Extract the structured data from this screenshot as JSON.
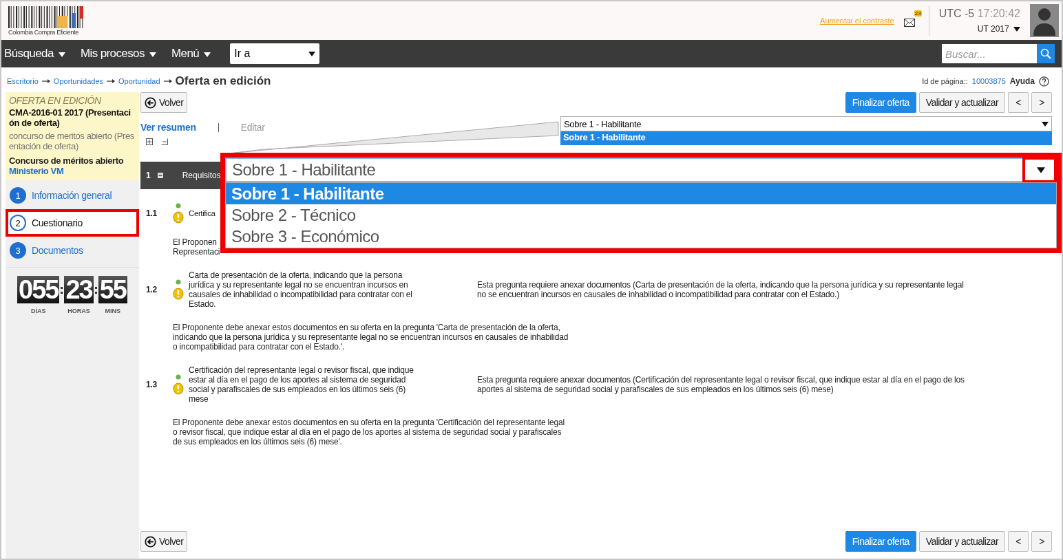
{
  "header": {
    "logo_text": "Colombia Compra Eficiente",
    "contrast_link": "Aumentar el contraste",
    "mail_badge": "23",
    "timezone": "UTC -5",
    "clock": "17:20:42",
    "user": "UT 2017"
  },
  "nav": {
    "items": [
      "Búsqueda",
      "Mis procesos",
      "Menú"
    ],
    "goto": {
      "value": "Ir a"
    },
    "search": {
      "placeholder": "Buscar..."
    }
  },
  "breadcrumb": {
    "links": [
      "Escritorio",
      "Oportunidades",
      "Oportunidad"
    ],
    "current": "Oferta en edición"
  },
  "page_id": {
    "label": "Id de página::",
    "value": "10003875",
    "help": "Ayuda"
  },
  "sidebar": {
    "status": "OFERTA EN EDICIÓN",
    "title": "CMA-2016-01 2017 (Presentación de oferta)",
    "description": "concurso de meritos abierto (Presentación de oferta)",
    "type": "Concurso de méritos abierto",
    "entity": "Ministerio VM",
    "steps": [
      {
        "number": "1",
        "label": "Información general",
        "selected": false
      },
      {
        "number": "2",
        "label": "Cuestionario",
        "selected": true
      },
      {
        "number": "3",
        "label": "Documentos",
        "selected": false
      }
    ],
    "countdown": [
      {
        "value": "055",
        "unit": "DÍAS"
      },
      {
        "value": "23",
        "unit": "HORAS"
      },
      {
        "value": "55",
        "unit": "MINS"
      }
    ]
  },
  "toolbars": [
    {
      "back": "Volver",
      "primary": "Finalizar oferta",
      "secondary": "Validar y actualizar",
      "prev": "<",
      "next": ">"
    },
    {
      "back": "Volver",
      "primary": "Finalizar oferta",
      "secondary": "Validar y actualizar",
      "prev": "<",
      "next": ">"
    }
  ],
  "view_links": [
    {
      "label": "Ver resumen",
      "disabled": false
    },
    {
      "label": "Editar",
      "disabled": true
    }
  ],
  "envelope_select": {
    "value": "Sobre 1 - Habilitante",
    "options": [
      {
        "label": "Sobre 1 - Habilitante",
        "selected": true
      }
    ]
  },
  "callout": {
    "value": "Sobre 1 - Habilitante",
    "options": [
      {
        "label": "Sobre 1 - Habilitante",
        "selected": true
      },
      {
        "label": "Sobre 2 - Técnico",
        "selected": false
      },
      {
        "label": "Sobre 3 - Económico",
        "selected": false
      }
    ]
  },
  "section": {
    "number": "1",
    "title": "Requisitos"
  },
  "questions": [
    {
      "number": "1.1",
      "question": "Certifica",
      "notes": [
        "El Proponen",
        "Representaci"
      ]
    },
    {
      "number": "1.2",
      "question": "Carta de presentación de la oferta, indicando que la persona jurídica y su representante legal no se encuentran incursos en causales de inhabilidad o incompatibilidad para contratar con el Estado.",
      "hint": "Esta pregunta requiere anexar documentos (Carta de presentación de la oferta, indicando que la persona jurídica y su representante legal no se encuentran incursos en causales de inhabilidad o incompatibilidad para contratar con el Estado.)",
      "notes": [
        "El Proponente debe anexar estos documentos en su oferta en la pregunta 'Carta de presentación de la oferta, indicando que la persona jurídica y su representante legal no se encuentran incursos en causales de inhabilidad o incompatibilidad para contratar con el Estado.'."
      ]
    },
    {
      "number": "1.3",
      "question": "Certificación del representante legal o revisor fiscal, que indique estar al día en el pago de los aportes al sistema de seguridad social y parafiscales de sus empleados en los últimos seis (6) mese",
      "hint": "Esta pregunta requiere anexar documentos (Certificación del representante legal o revisor fiscal, que indique estar al día en el pago de los aportes al sistema de seguridad social y parafiscales de sus empleados en los últimos seis (6) mese)",
      "notes": [
        "El Proponente debe anexar estos documentos en su oferta en la pregunta 'Certificación del representante legal o revisor fiscal, que indique estar al día en el pago de los aportes al sistema de seguridad social y parafiscales de sus empleados en los últimos seis (6) mese'."
      ]
    }
  ]
}
